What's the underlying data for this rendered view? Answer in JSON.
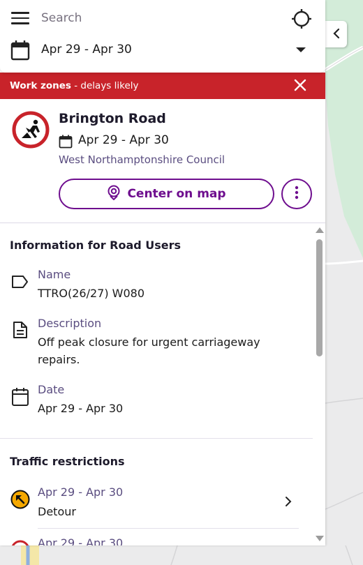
{
  "search": {
    "placeholder": "Search"
  },
  "date_filter": {
    "value": "Apr 29 - Apr 30"
  },
  "banner": {
    "label_bold": "Work zones",
    "label_rest": " - delays likely"
  },
  "incident": {
    "title": "Brington Road",
    "dates": "Apr 29 - Apr 30",
    "authority": "West Northamptonshire Council",
    "center_button": "Center on map"
  },
  "info": {
    "section_title": "Information for Road Users",
    "name_label": "Name",
    "name_value": "TTRO(26/27) W080",
    "description_label": "Description",
    "description_value": "Off peak closure for urgent carriageway repairs.",
    "date_label": "Date",
    "date_value": "Apr 29 - Apr 30"
  },
  "restrictions": {
    "section_title": "Traffic restrictions",
    "items": [
      {
        "dates": "Apr 29 - Apr 30",
        "type": "Detour"
      },
      {
        "dates": "Apr 29 - Apr 30",
        "type": ""
      }
    ]
  },
  "colors": {
    "banner": "#c8232a",
    "accent": "#6e0d8e",
    "muted_text": "#5a4d80",
    "detour_icon": "#f5a800"
  },
  "icons": [
    "menu-icon",
    "locate-icon",
    "calendar-icon",
    "chevron-down-icon",
    "close-icon",
    "roadwork-icon",
    "map-pin-icon",
    "more-vertical-icon",
    "tag-icon",
    "document-icon",
    "detour-icon",
    "chevron-right-icon",
    "chevron-left-icon"
  ]
}
